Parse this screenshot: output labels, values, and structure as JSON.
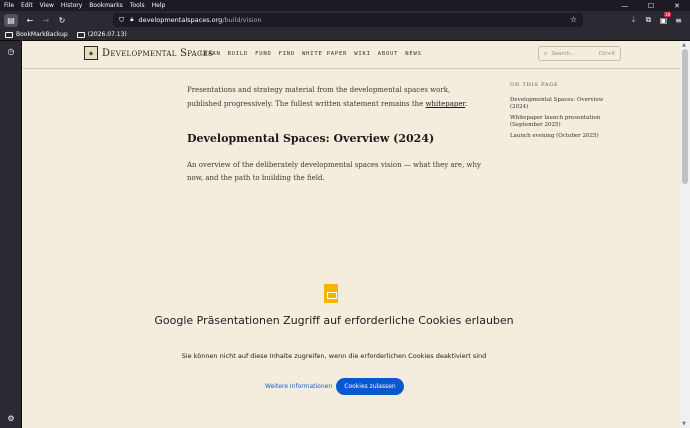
{
  "menu": [
    "File",
    "Edit",
    "View",
    "History",
    "Bookmarks",
    "Tools",
    "Help"
  ],
  "url": {
    "host": "developmentalspaces.org",
    "path": "/build/vision"
  },
  "extension_badge": "18",
  "bookmarks": [
    "BookMarkBackup",
    "(2026.07.13)"
  ],
  "site": {
    "logo": "Developmental Spaces",
    "nav": [
      "LEARN",
      "BUILD",
      "FUND",
      "FIND",
      "WHITE PAPER",
      "WIKI",
      "ABOUT",
      "NEWS"
    ],
    "search_placeholder": "Search...",
    "search_shortcut": "Ctrl+K"
  },
  "content": {
    "intro_1": "Presentations and strategy material from the developmental spaces work, published progressively. The fullest written statement remains the ",
    "intro_link": "whitepaper",
    "intro_end": ".",
    "heading": "Developmental Spaces: Overview (2024)",
    "description": "An overview of the deliberately developmental spaces vision — what they are, why now, and the path to building the field."
  },
  "toc": {
    "title": "ON THIS PAGE",
    "items": [
      "Developmental Spaces: Overview (2024)",
      "Whitepaper launch presentation (September 2025)",
      "Launch evening (October 2025)"
    ]
  },
  "consent": {
    "title": "Google Präsentationen Zugriff auf erforderliche Cookies erlauben",
    "text": "Sie können nicht auf diese Inhalte zugreifen, wenn die erforderlichen Cookies deaktiviert sind",
    "more": "Weitere Informationen",
    "allow": "Cookies zulassen"
  }
}
